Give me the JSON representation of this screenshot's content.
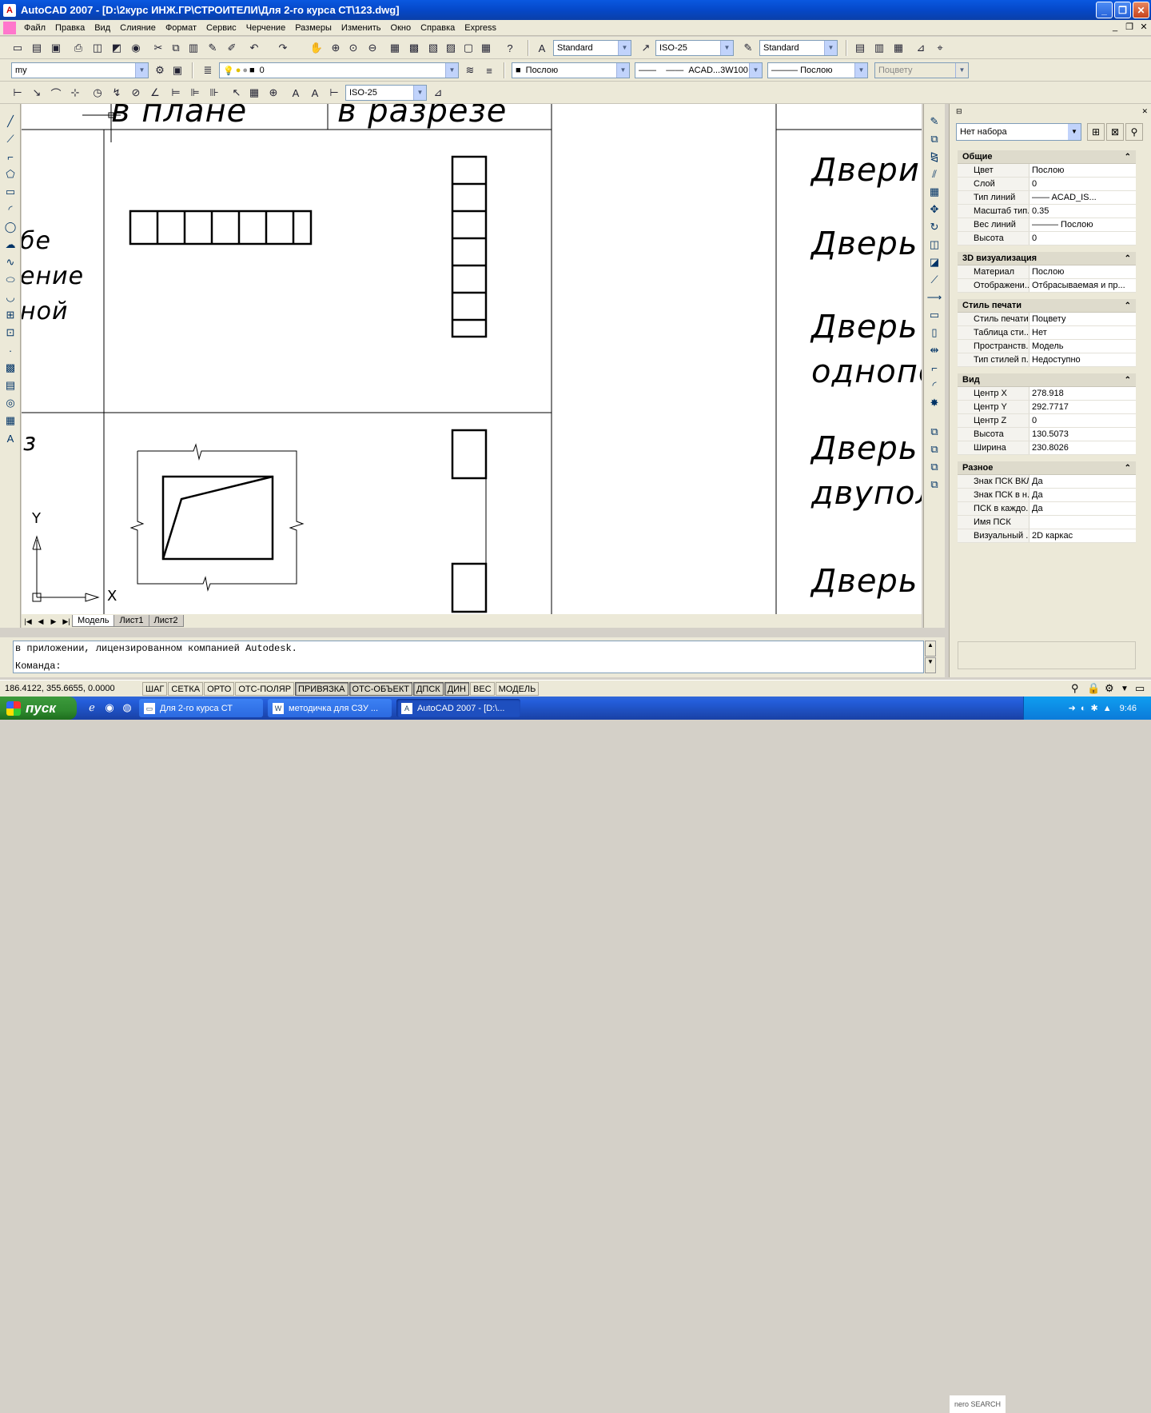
{
  "window": {
    "title": "AutoCAD 2007 - [D:\\2курс ИНЖ.ГР\\СТРОИТЕЛИ\\Для 2-го курса СТ\\123.dwg]"
  },
  "menu": [
    "Файл",
    "Правка",
    "Вид",
    "Слияние",
    "Формат",
    "Сервис",
    "Черчение",
    "Размеры",
    "Изменить",
    "Окно",
    "Справка",
    "Express"
  ],
  "toolbar": {
    "text_style": "Standard",
    "dim_style": "ISO-25",
    "table_style": "Standard",
    "workspace": "my",
    "layer": "0",
    "color": "Послою",
    "linetype": "ACAD...3W100",
    "lineweight": "Послою",
    "plotstyle": "Поцвету",
    "dim_style2": "ISO-25"
  },
  "drawing": {
    "header_texts": [
      "в плане",
      "в разрезе"
    ],
    "left_texts": [
      "бе",
      "ение",
      "ной",
      "з"
    ],
    "right_texts": [
      "Двери",
      "Дверь",
      "Дверь",
      "однопо",
      "Дверь",
      "двупол",
      "Дверь"
    ],
    "ucs_x": "X",
    "ucs_y": "Y"
  },
  "layout_tabs": [
    "Модель",
    "Лист1",
    "Лист2"
  ],
  "command": {
    "history": "в приложении, лицензированном компанией Autodesk.",
    "prompt": "Команда:"
  },
  "status": {
    "coords": "186.4122, 355.6655, 0.0000",
    "buttons": [
      "ШАГ",
      "СЕТКА",
      "ОРТО",
      "ОТС-ПОЛЯР",
      "ПРИВЯЗКА",
      "ОТС-ОБЪЕКТ",
      "ДПСК",
      "ДИН",
      "ВЕС",
      "МОДЕЛЬ"
    ]
  },
  "properties": {
    "selection": "Нет набора",
    "sections": [
      {
        "title": "Общие",
        "rows": [
          {
            "k": "Цвет",
            "v": "Послою"
          },
          {
            "k": "Слой",
            "v": "0"
          },
          {
            "k": "Тип линий",
            "v": "—— ACAD_IS..."
          },
          {
            "k": "Масштаб тип...",
            "v": "0.35"
          },
          {
            "k": "Вес линий",
            "v": "——— Послою"
          },
          {
            "k": "Высота",
            "v": "0"
          }
        ]
      },
      {
        "title": "3D визуализация",
        "rows": [
          {
            "k": "Материал",
            "v": "Послою"
          },
          {
            "k": "Отображени...",
            "v": "Отбрасываемая и пр..."
          }
        ]
      },
      {
        "title": "Стиль печати",
        "rows": [
          {
            "k": "Стиль печати",
            "v": "Поцвету"
          },
          {
            "k": "Таблица сти...",
            "v": "Нет"
          },
          {
            "k": "Пространств...",
            "v": "Модель"
          },
          {
            "k": "Тип стилей п...",
            "v": "Недоступно"
          }
        ]
      },
      {
        "title": "Вид",
        "rows": [
          {
            "k": "Центр X",
            "v": "278.918"
          },
          {
            "k": "Центр Y",
            "v": "292.7717"
          },
          {
            "k": "Центр Z",
            "v": "0"
          },
          {
            "k": "Высота",
            "v": "130.5073"
          },
          {
            "k": "Ширина",
            "v": "230.8026"
          }
        ]
      },
      {
        "title": "Разное",
        "rows": [
          {
            "k": "Знак ПСК ВКЛ",
            "v": "Да"
          },
          {
            "k": "Знак ПСК в н...",
            "v": "Да"
          },
          {
            "k": "ПСК в каждо...",
            "v": "Да"
          },
          {
            "k": "Имя ПСК",
            "v": ""
          },
          {
            "k": "Визуальный ...",
            "v": "2D каркас"
          }
        ]
      }
    ]
  },
  "taskbar": {
    "start": "пуск",
    "tasks": [
      "Для 2-го курса СТ",
      "методичка для СЗУ ...",
      "AutoCAD 2007 - [D:\\..."
    ],
    "nero": "nero SEARCH",
    "clock": "9:46"
  }
}
